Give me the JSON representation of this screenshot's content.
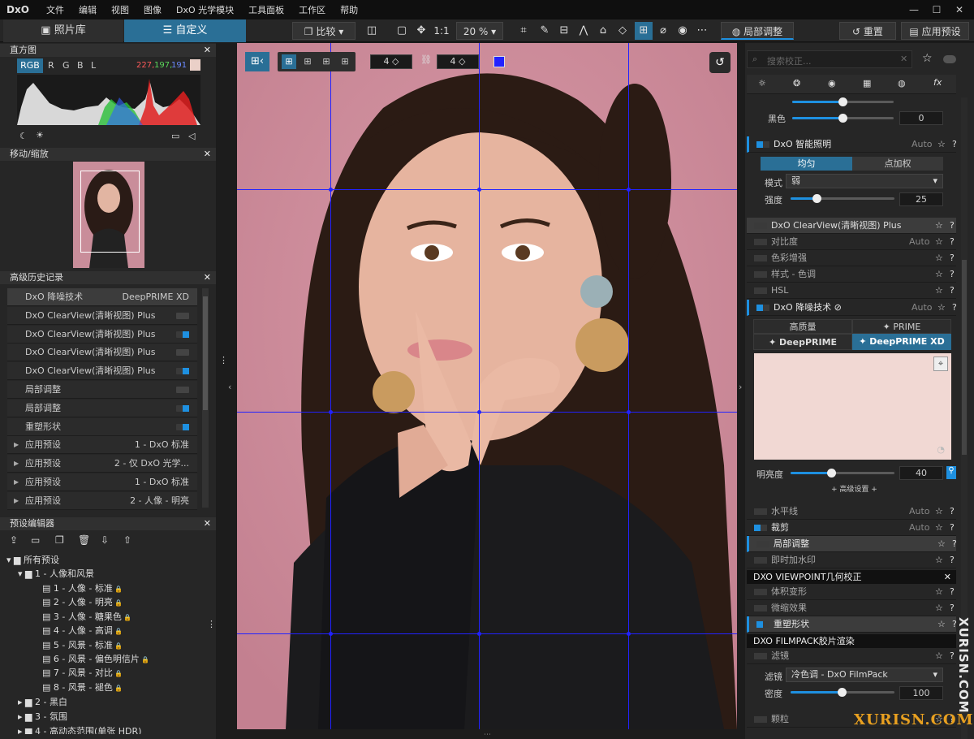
{
  "menubar": {
    "logo": "DxO",
    "items": [
      "文件",
      "编辑",
      "视图",
      "图像",
      "DxO 光学模块",
      "工具面板",
      "工作区",
      "帮助"
    ]
  },
  "tabs": {
    "library": "照片库",
    "customize": "自定义"
  },
  "toolbar": {
    "compare": "比较",
    "ratio": "1:1",
    "zoom": "20 %",
    "local_adjust": "局部调整",
    "reset": "重置",
    "apply_preset": "应用预设"
  },
  "histogram": {
    "title": "直方图",
    "channels": [
      "RGB",
      "R",
      "G",
      "B",
      "L"
    ],
    "values": {
      "r": "227,",
      "g": "197,",
      "b": "191"
    },
    "swatch": "#ead0c8"
  },
  "navigator": {
    "title": "移动/缩放"
  },
  "history": {
    "title": "高级历史记录",
    "items": [
      {
        "label": "DxO 降噪技术",
        "value": "DeepPRIME XD",
        "toggle": ""
      },
      {
        "label": "DxO ClearView(清晰视图) Plus",
        "value": "",
        "toggle": "off"
      },
      {
        "label": "DxO ClearView(清晰视图) Plus",
        "value": "",
        "toggle": "on"
      },
      {
        "label": "DxO ClearView(清晰视图) Plus",
        "value": "",
        "toggle": "off"
      },
      {
        "label": "DxO ClearView(清晰视图) Plus",
        "value": "",
        "toggle": "on"
      },
      {
        "label": "局部调整",
        "value": "",
        "toggle": "off"
      },
      {
        "label": "局部调整",
        "value": "",
        "toggle": "on"
      },
      {
        "label": "重塑形状",
        "value": "",
        "toggle": "on"
      },
      {
        "label": "应用预设",
        "value": "1 - DxO 标准",
        "toggle": ""
      },
      {
        "label": "应用预设",
        "value": "2 - 仅 DxO 光学...",
        "toggle": ""
      },
      {
        "label": "应用预设",
        "value": "1 - DxO 标准",
        "toggle": ""
      },
      {
        "label": "应用预设",
        "value": "2 - 人像 - 明亮",
        "toggle": ""
      }
    ]
  },
  "preset_editor": {
    "title": "预设编辑器",
    "root": "所有预设",
    "group1": "1 - 人像和风景",
    "presets": [
      "1 - 人像 - 标准",
      "2 - 人像 - 明亮",
      "3 - 人像 - 糖果色",
      "4 - 人像 - 高调",
      "5 - 风景 - 标准",
      "6 - 风景 - 偏色明信片",
      "7 - 风景 - 对比",
      "8 - 风景 - 褪色"
    ],
    "group2": "2 - 黑白",
    "group3": "3 - 氛围",
    "group4": "4 - 高动态范围(单张 HDR)"
  },
  "grid_controls": {
    "cols": "4",
    "rows": "4"
  },
  "right": {
    "search_placeholder": "搜索校正...",
    "black_label": "黑色",
    "black_value": "0",
    "smart_light": {
      "name": "DxO 智能照明",
      "auto": "Auto",
      "tab1": "均匀",
      "tab2": "点加权",
      "mode_label": "模式",
      "mode_value": "弱",
      "strength_label": "强度",
      "strength_value": "25"
    },
    "clearview": "DxO ClearView(清晰视图) Plus",
    "contrast": "对比度",
    "contrast_auto": "Auto",
    "color_boost": "色彩增强",
    "style_tone": "样式 - 色调",
    "hsl": "HSL",
    "noise": {
      "name": "DxO 降噪技术",
      "auto": "Auto",
      "hq": "高质量",
      "prime": "PRIME",
      "deepprime": "DeepPRIME",
      "deepprimexd": "DeepPRIME XD",
      "lum_label": "明亮度",
      "lum_value": "40",
      "advanced": "+ 高级设置 +"
    },
    "horizon": "水平线",
    "horizon_auto": "Auto",
    "crop": "裁剪",
    "crop_auto": "Auto",
    "local": "局部调整",
    "watermark": "即时加水印",
    "viewpoint_head": "DXO VIEWPOINT几何校正",
    "volume": "体积变形",
    "miniature": "微缩效果",
    "reshape": "重塑形状",
    "filmpack_head": "DXO FILMPACK胶片渲染",
    "filter": "滤镜",
    "filter_label": "滤镜",
    "filter_value": "冷色调 - DxO FilmPack",
    "density_label": "密度",
    "density_value": "100",
    "grain": "颗粒"
  },
  "watermark_text": {
    "v": "XURISN.COM",
    "h": "XURISN.COM"
  },
  "colors": {
    "accent": "#1e90e0",
    "photo_bg": "#c98d9a",
    "grid": "#2222ff"
  }
}
